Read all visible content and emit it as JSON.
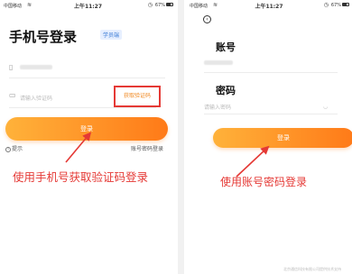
{
  "left_screen": {
    "status_bar": {
      "carrier": "中国移动",
      "time": "上午11:27",
      "battery": "67%"
    },
    "title": "手机号登录",
    "badge": "学员端",
    "code_placeholder": "请输入验证码",
    "get_code_button": "获取验证码",
    "login_button": "登录",
    "tip": "提示",
    "alt_login_link": "账号密码登录",
    "annotation": "使用手机号获取验证码登录"
  },
  "right_screen": {
    "status_bar": {
      "carrier": "中国移动",
      "time": "上午11:27",
      "battery": "67%"
    },
    "account_label": "账号",
    "password_label": "密码",
    "password_placeholder": "请输入密码",
    "login_button": "登录",
    "annotation": "使用账号密码登录",
    "footer_note": "北京通信科技有限公司提供技术支持"
  },
  "colors": {
    "accent": "#ff8a1f",
    "annotation": "#e53935",
    "badge": "#3a7bd5"
  }
}
